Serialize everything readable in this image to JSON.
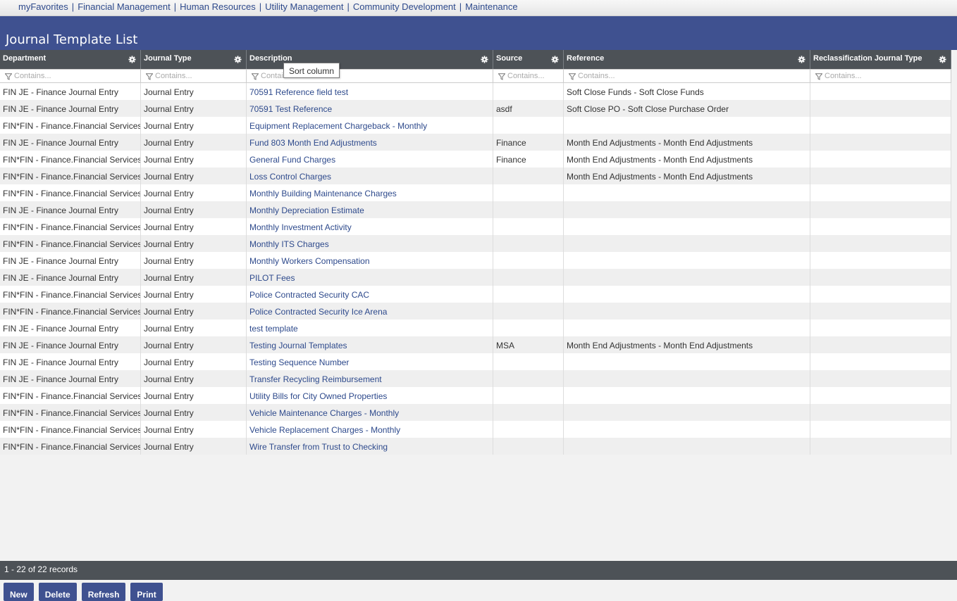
{
  "nav": {
    "items": [
      "myFavorites",
      "Financial Management",
      "Human Resources",
      "Utility Management",
      "Community Development",
      "Maintenance"
    ],
    "separator": "|"
  },
  "page": {
    "title": "Journal Template List"
  },
  "columns": [
    {
      "label": "Department",
      "placeholder": "Contains..."
    },
    {
      "label": "Journal Type",
      "placeholder": "Contains..."
    },
    {
      "label": "Description",
      "placeholder": "Contains..."
    },
    {
      "label": "Source",
      "placeholder": "Contains..."
    },
    {
      "label": "Reference",
      "placeholder": "Contains..."
    },
    {
      "label": "Reclassification Journal Type",
      "placeholder": "Contains..."
    }
  ],
  "rows": [
    [
      "FIN JE - Finance Journal Entry",
      "Journal Entry",
      "70591 Reference field test",
      "",
      "Soft Close Funds - Soft Close Funds",
      ""
    ],
    [
      "FIN JE - Finance Journal Entry",
      "Journal Entry",
      "70591 Test Reference",
      "asdf",
      "Soft Close PO - Soft Close Purchase Order",
      ""
    ],
    [
      "FIN*FIN - Finance.Financial Services",
      "Journal Entry",
      "Equipment Replacement Chargeback - Monthly",
      "",
      "",
      ""
    ],
    [
      "FIN JE - Finance Journal Entry",
      "Journal Entry",
      "Fund 803 Month End Adjustments",
      "Finance",
      "Month End Adjustments - Month End Adjustments",
      ""
    ],
    [
      "FIN*FIN - Finance.Financial Services",
      "Journal Entry",
      "General Fund Charges",
      "Finance",
      "Month End Adjustments - Month End Adjustments",
      ""
    ],
    [
      "FIN*FIN - Finance.Financial Services",
      "Journal Entry",
      "Loss Control Charges",
      "",
      "Month End Adjustments - Month End Adjustments",
      ""
    ],
    [
      "FIN*FIN - Finance.Financial Services",
      "Journal Entry",
      "Monthly Building Maintenance Charges",
      "",
      "",
      ""
    ],
    [
      "FIN JE - Finance Journal Entry",
      "Journal Entry",
      "Monthly Depreciation Estimate",
      "",
      "",
      ""
    ],
    [
      "FIN*FIN - Finance.Financial Services",
      "Journal Entry",
      "Monthly Investment Activity",
      "",
      "",
      ""
    ],
    [
      "FIN*FIN - Finance.Financial Services",
      "Journal Entry",
      "Monthly ITS Charges",
      "",
      "",
      ""
    ],
    [
      "FIN JE - Finance Journal Entry",
      "Journal Entry",
      "Monthly Workers Compensation",
      "",
      "",
      ""
    ],
    [
      "FIN JE - Finance Journal Entry",
      "Journal Entry",
      "PILOT Fees",
      "",
      "",
      ""
    ],
    [
      "FIN*FIN - Finance.Financial Services",
      "Journal Entry",
      "Police Contracted Security CAC",
      "",
      "",
      ""
    ],
    [
      "FIN*FIN - Finance.Financial Services",
      "Journal Entry",
      "Police Contracted Security Ice Arena",
      "",
      "",
      ""
    ],
    [
      "FIN JE - Finance Journal Entry",
      "Journal Entry",
      "test template",
      "",
      "",
      ""
    ],
    [
      "FIN JE - Finance Journal Entry",
      "Journal Entry",
      "Testing Journal Templates",
      "MSA",
      "Month End Adjustments - Month End Adjustments",
      ""
    ],
    [
      "FIN JE - Finance Journal Entry",
      "Journal Entry",
      "Testing Sequence Number",
      "",
      "",
      ""
    ],
    [
      "FIN JE - Finance Journal Entry",
      "Journal Entry",
      "Transfer Recycling Reimbursement",
      "",
      "",
      ""
    ],
    [
      "FIN*FIN - Finance.Financial Services",
      "Journal Entry",
      "Utility Bills for City Owned Properties",
      "",
      "",
      ""
    ],
    [
      "FIN*FIN - Finance.Financial Services",
      "Journal Entry",
      "Vehicle Maintenance Charges - Monthly",
      "",
      "",
      ""
    ],
    [
      "FIN*FIN - Finance.Financial Services",
      "Journal Entry",
      "Vehicle Replacement Charges - Monthly",
      "",
      "",
      ""
    ],
    [
      "FIN*FIN - Finance.Financial Services",
      "Journal Entry",
      "Wire Transfer from Trust to Checking",
      "",
      "",
      ""
    ]
  ],
  "tooltip": {
    "text": "Sort column"
  },
  "footer": {
    "record_count": "1 - 22 of 22 records"
  },
  "actions": {
    "new": "New",
    "delete": "Delete",
    "refresh": "Refresh",
    "print": "Print"
  },
  "icons": {
    "gear": "gear-icon",
    "filter": "filter-icon"
  },
  "colors": {
    "header_band": "#3f5190",
    "grid_header": "#4d5257",
    "link": "#2e4a8c"
  }
}
